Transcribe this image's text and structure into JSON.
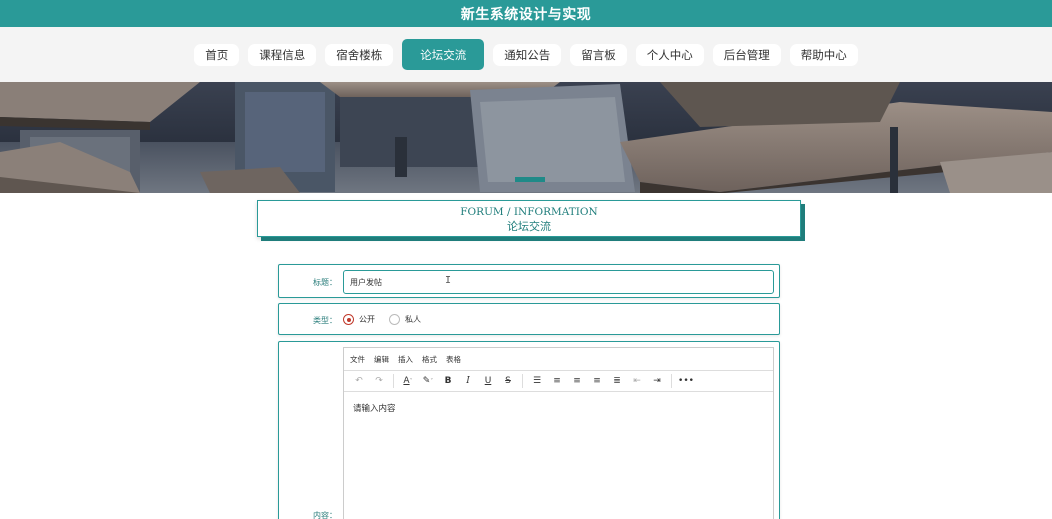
{
  "header": {
    "title": "新生系统设计与实现"
  },
  "nav": {
    "items": [
      {
        "label": "首页",
        "active": false
      },
      {
        "label": "课程信息",
        "active": false
      },
      {
        "label": "宿舍楼栋",
        "active": false
      },
      {
        "label": "论坛交流",
        "active": true
      },
      {
        "label": "通知公告",
        "active": false
      },
      {
        "label": "留言板",
        "active": false
      },
      {
        "label": "个人中心",
        "active": false
      },
      {
        "label": "后台管理",
        "active": false
      },
      {
        "label": "帮助中心",
        "active": false
      }
    ]
  },
  "section": {
    "title_en": "FORUM / INFORMATION",
    "title_zh": "论坛交流"
  },
  "form": {
    "title_label": "标题：",
    "title_value": "用户发帖",
    "type_label": "类型：",
    "type_options": [
      {
        "label": "公开",
        "selected": true
      },
      {
        "label": "私人",
        "selected": false
      }
    ],
    "content_label": "内容：",
    "editor": {
      "menu": [
        "文件",
        "编辑",
        "插入",
        "格式",
        "表格"
      ],
      "placeholder": "请输入内容"
    }
  },
  "colors": {
    "primary": "#2a9a98"
  }
}
